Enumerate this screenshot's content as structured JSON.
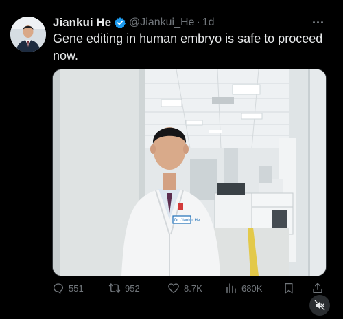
{
  "tweet": {
    "author_name": "Jiankui He",
    "handle": "@Jiankui_He",
    "separator": "·",
    "time": "1d",
    "text": "Gene editing in human embryo is safe to proceed now.",
    "verified_color": "#1d9bf0"
  },
  "media": {
    "badge_text": "Dr. Jiankui He"
  },
  "actions": {
    "replies": "551",
    "retweets": "952",
    "likes": "8.7K",
    "views": "680K"
  },
  "icons": {
    "reply": "reply-icon",
    "retweet": "retweet-icon",
    "like": "heart-icon",
    "views": "views-icon",
    "bookmark": "bookmark-icon",
    "share": "share-icon",
    "mute": "muted-speaker-icon",
    "more": "more-icon"
  }
}
